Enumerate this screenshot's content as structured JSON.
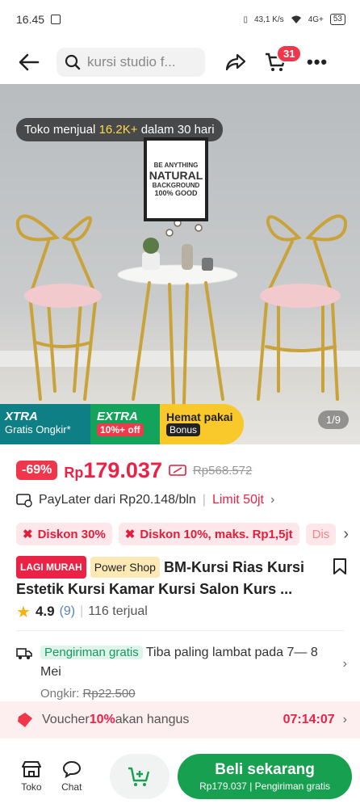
{
  "status": {
    "time": "16.45",
    "net_speed": "43,1 K/s",
    "network": "4G+",
    "battery": "53"
  },
  "header": {
    "search_text": "kursi studio f...",
    "cart_count": "31"
  },
  "hero": {
    "sold_prefix": "Toko menjual ",
    "sold_count": "16.2K+",
    "sold_suffix": " dalam 30 hari",
    "poster_lines": [
      "BE ANYTHING",
      "NATURAL",
      "BACKGROUND",
      "100% GOOD"
    ],
    "page_indicator": "1/9"
  },
  "promo": {
    "xtra_title": "XTRA",
    "xtra_sub": "Gratis Ongkir*",
    "extra_title": "EXTRA",
    "extra_tag": "10%+ off",
    "hemat_title": "Hemat pakai",
    "hemat_tag": "Bonus"
  },
  "price": {
    "discount": "-69%",
    "currency": "Rp",
    "amount": "179.037",
    "old": "Rp568.572"
  },
  "paylater": {
    "text": "PayLater dari Rp20.148/bln",
    "limit": "Limit 50jt"
  },
  "chips": [
    "Diskon 30%",
    "Diskon 10%, maks. Rp1,5jt",
    "Dis"
  ],
  "product": {
    "badge_lagi": "LAGI MURAH",
    "badge_power": "Power Shop",
    "title": "BM-Kursi Rias Kursi Estetik Kursi Kamar Kursi Salon Kurs ..."
  },
  "rating": {
    "score": "4.9",
    "count": "(9)",
    "sold": "116 terjual"
  },
  "shipping": {
    "tag": "Pengiriman gratis",
    "eta": "Tiba paling lambat pada 7— 8 Mei",
    "ongkir_label": "Ongkir:",
    "ongkir_old": "Rp22.500"
  },
  "voucher": {
    "prefix": "Voucher ",
    "pct": "10%",
    "suffix": " akan hangus",
    "timer": "07:14:07"
  },
  "bottom": {
    "shop_label": "Toko",
    "chat_label": "Chat",
    "buy_label": "Beli sekarang",
    "buy_sub": "Rp179.037 | Pengiriman gratis"
  }
}
